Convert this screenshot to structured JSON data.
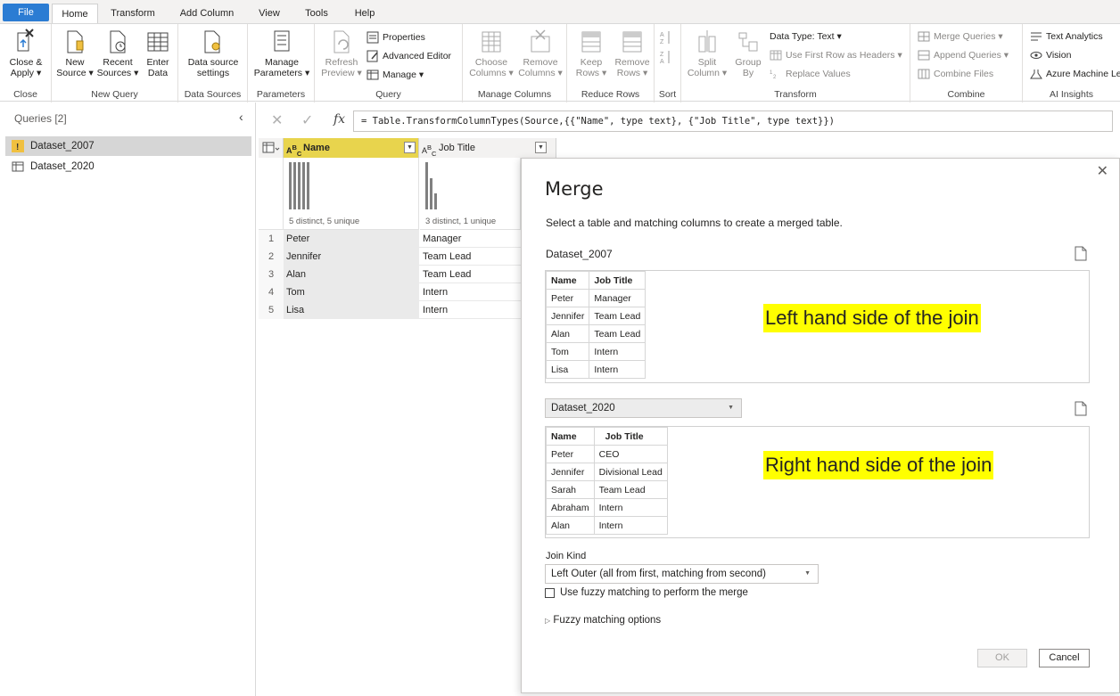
{
  "tabs": [
    "File",
    "Home",
    "Transform",
    "Add Column",
    "View",
    "Tools",
    "Help"
  ],
  "ribbon": {
    "close": {
      "label1": "Close &",
      "label2": "Apply ▾",
      "group": "Close"
    },
    "new_query": {
      "new_source": [
        "New",
        "Source ▾"
      ],
      "recent_sources": [
        "Recent",
        "Sources ▾"
      ],
      "enter_data": [
        "Enter",
        "Data"
      ],
      "group": "New Query"
    },
    "data_sources": {
      "label1": "Data source",
      "label2": "settings",
      "group": "Data Sources"
    },
    "parameters": {
      "label1": "Manage",
      "label2": "Parameters ▾",
      "group": "Parameters"
    },
    "query": {
      "refresh": [
        "Refresh",
        "Preview ▾"
      ],
      "properties": "Properties",
      "advanced_editor": "Advanced Editor",
      "manage": "Manage ▾",
      "group": "Query"
    },
    "manage_columns": {
      "choose": [
        "Choose",
        "Columns ▾"
      ],
      "remove": [
        "Remove",
        "Columns ▾"
      ],
      "group": "Manage Columns"
    },
    "reduce_rows": {
      "keep": [
        "Keep",
        "Rows ▾"
      ],
      "remove": [
        "Remove",
        "Rows ▾"
      ],
      "group": "Reduce Rows"
    },
    "sort": {
      "group": "Sort"
    },
    "transform": {
      "split": [
        "Split",
        "Column ▾"
      ],
      "group_by": [
        "Group",
        "By"
      ],
      "data_type": "Data Type: Text ▾",
      "first_row": "Use First Row as Headers ▾",
      "replace": "Replace Values",
      "group": "Transform"
    },
    "combine": {
      "merge": "Merge Queries ▾",
      "append": "Append Queries ▾",
      "combine_files": "Combine Files",
      "group": "Combine"
    },
    "ai": {
      "text_analytics": "Text Analytics",
      "vision": "Vision",
      "azure_ml": "Azure Machine Le",
      "group": "AI Insights"
    }
  },
  "queries": {
    "title": "Queries [2]",
    "items": [
      "Dataset_2007",
      "Dataset_2020"
    ]
  },
  "formula": "= Table.TransformColumnTypes(Source,{{\"Name\", type text}, {\"Job Title\", type text}})",
  "grid": {
    "columns": [
      "Name",
      "Job Title"
    ],
    "profile": [
      "5 distinct, 5 unique",
      "3 distinct, 1 unique"
    ],
    "rows": [
      [
        "1",
        "Peter",
        "Manager"
      ],
      [
        "2",
        "Jennifer",
        "Team Lead"
      ],
      [
        "3",
        "Alan",
        "Team Lead"
      ],
      [
        "4",
        "Tom",
        "Intern"
      ],
      [
        "5",
        "Lisa",
        "Intern"
      ]
    ]
  },
  "merge": {
    "title": "Merge",
    "description": "Select a table and matching columns to create a merged table.",
    "table1_name": "Dataset_2007",
    "table1": {
      "headers": [
        "Name",
        "Job Title"
      ],
      "rows": [
        [
          "Peter",
          "Manager"
        ],
        [
          "Jennifer",
          "Team Lead"
        ],
        [
          "Alan",
          "Team Lead"
        ],
        [
          "Tom",
          "Intern"
        ],
        [
          "Lisa",
          "Intern"
        ]
      ]
    },
    "left_note": "Left hand side of the join",
    "table2_selected": "Dataset_2020",
    "table2": {
      "headers": [
        "Name",
        "Job Title"
      ],
      "rows": [
        [
          "Peter",
          "CEO"
        ],
        [
          "Jennifer",
          "Divisional Lead"
        ],
        [
          "Sarah",
          "Team Lead"
        ],
        [
          "Abraham",
          "Intern"
        ],
        [
          "Alan",
          "Intern"
        ]
      ]
    },
    "right_note": "Right hand side of the join",
    "join_kind_label": "Join Kind",
    "join_kind": "Left Outer (all from first, matching from second)",
    "fuzzy_checkbox": "Use fuzzy matching to perform the merge",
    "fuzzy_options": "Fuzzy matching options",
    "ok": "OK",
    "cancel": "Cancel"
  },
  "colors": {
    "accent": "#2b7cd3",
    "column_header_highlight": "#e8d44d",
    "annotation_highlight": "#ffff00"
  }
}
